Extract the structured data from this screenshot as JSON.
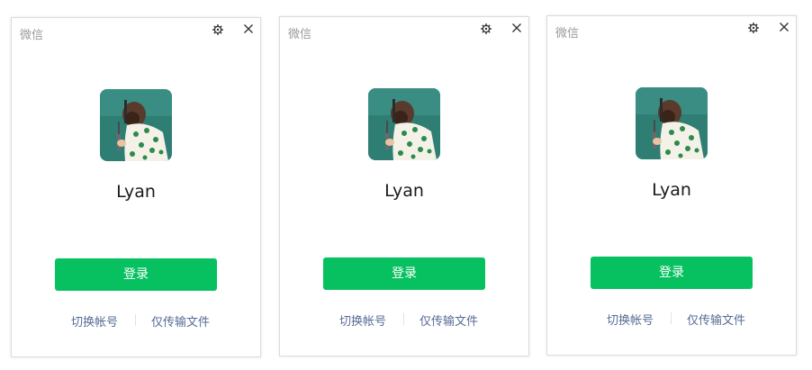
{
  "colors": {
    "primary_button": "#07c160",
    "link": "#576b95",
    "title_text": "#9a9a9a"
  },
  "windows": [
    {
      "title": "微信",
      "user_name": "Lyan",
      "login_label": "登录",
      "switch_account_label": "切换帐号",
      "transfer_only_label": "仅传输文件",
      "icons": [
        "gear-icon",
        "close-icon",
        "avatar"
      ]
    },
    {
      "title": "微信",
      "user_name": "Lyan",
      "login_label": "登录",
      "switch_account_label": "切换帐号",
      "transfer_only_label": "仅传输文件",
      "icons": [
        "gear-icon",
        "close-icon",
        "avatar"
      ]
    },
    {
      "title": "微信",
      "user_name": "Lyan",
      "login_label": "登录",
      "switch_account_label": "切换帐号",
      "transfer_only_label": "仅传输文件",
      "icons": [
        "gear-icon",
        "close-icon",
        "avatar"
      ]
    }
  ]
}
